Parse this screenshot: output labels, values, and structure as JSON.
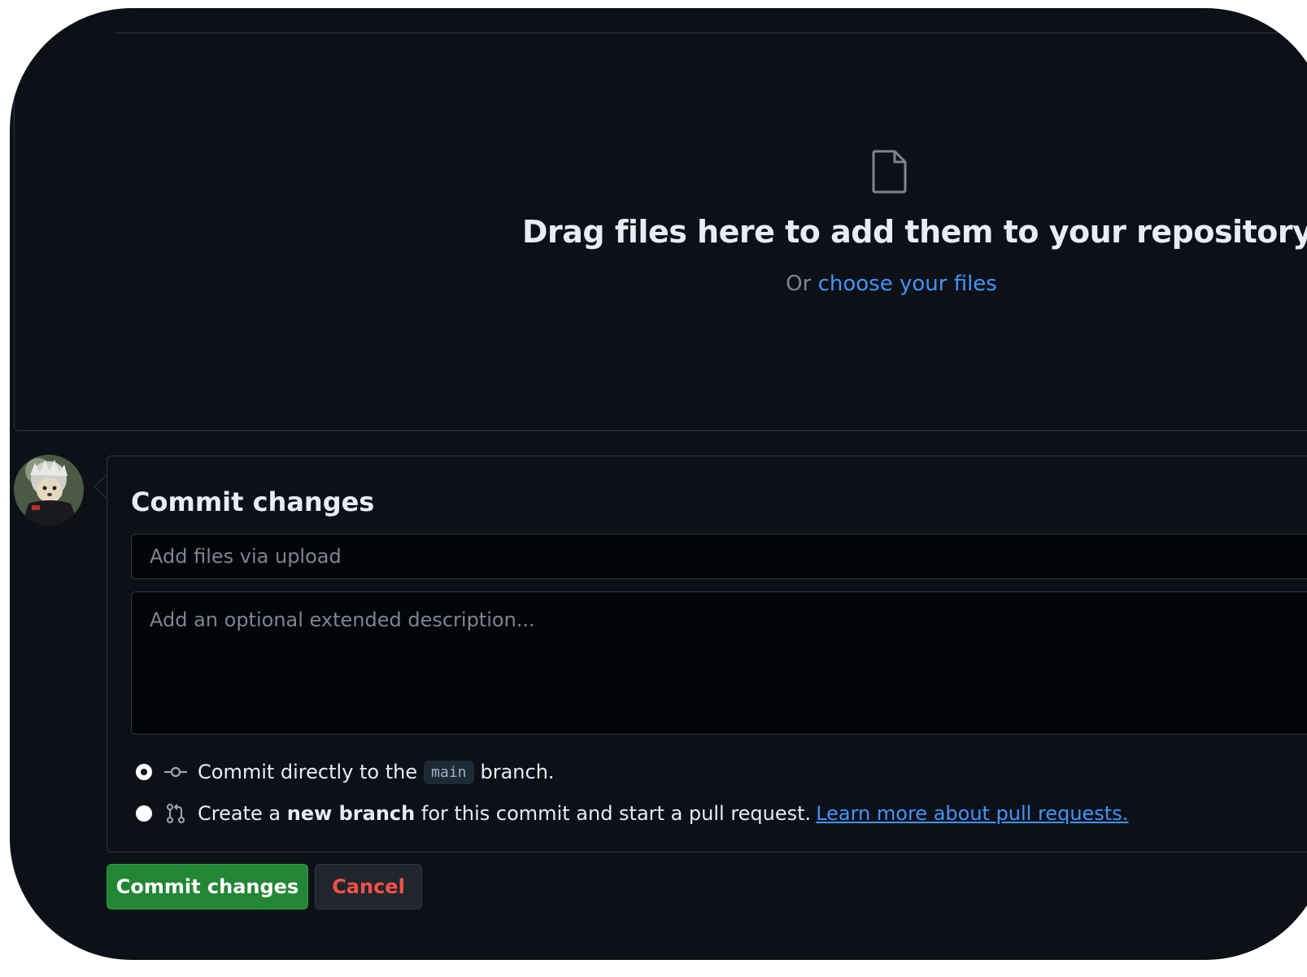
{
  "colors": {
    "background": "#0d1117",
    "border": "#30363d",
    "text": "#e6edf3",
    "muted": "#7d8590",
    "link": "#4493f8",
    "commit_button": "#238636",
    "cancel_text": "#f85149"
  },
  "dropzone": {
    "icon": "file-icon",
    "title": "Drag files here to add them to your repository",
    "subtitle_prefix": "Or",
    "subtitle_link": "choose your files"
  },
  "commit": {
    "title": "Commit changes",
    "summary_placeholder": "Add files via upload",
    "description_placeholder": "Add an optional extended description...",
    "options": {
      "direct": {
        "icon": "git-commit-icon",
        "prefix": "Commit directly to the",
        "branch": "main",
        "suffix": "branch.",
        "checked": true
      },
      "new_branch": {
        "icon": "git-pull-request-icon",
        "prefix": "Create a",
        "bold": "new branch",
        "suffix": "for this commit and start a pull request.",
        "link": "Learn more about pull requests.",
        "checked": false
      }
    }
  },
  "buttons": {
    "commit": "Commit changes",
    "cancel": "Cancel"
  }
}
